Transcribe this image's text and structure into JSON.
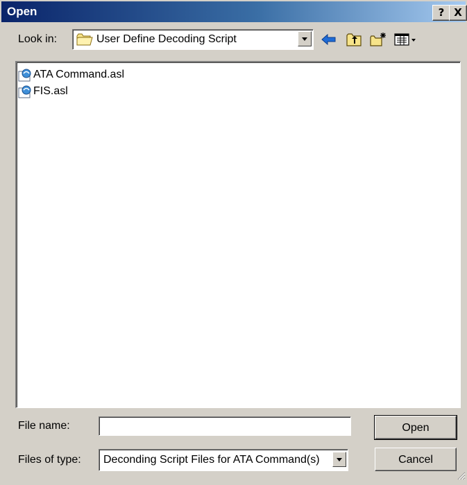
{
  "window": {
    "title": "Open",
    "help_label": "?",
    "close_label": "X"
  },
  "lookin": {
    "label": "Look in:",
    "value": "User Define Decoding Script"
  },
  "files": [
    {
      "name": "ATA Command.asl",
      "icon": "script-file-icon"
    },
    {
      "name": "FIS.asl",
      "icon": "script-file-icon"
    }
  ],
  "filename": {
    "label": "File name:",
    "value": "",
    "placeholder": ""
  },
  "filetype": {
    "label": "Files of type:",
    "value": "Deconding Script Files for ATA Command(s)"
  },
  "buttons": {
    "open": "Open",
    "cancel": "Cancel"
  },
  "colors": {
    "titlebar_start": "#0a246a",
    "titlebar_end": "#a6caf0",
    "face": "#d4d0c8"
  }
}
